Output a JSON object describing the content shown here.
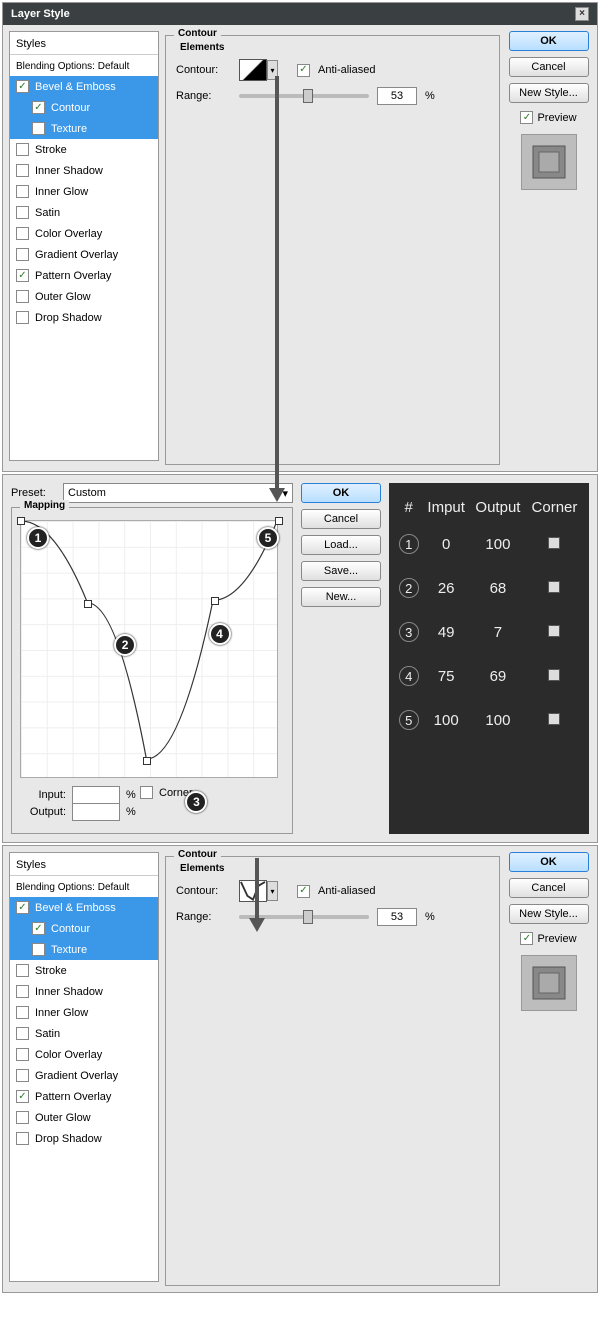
{
  "window": {
    "title": "Layer Style"
  },
  "styles_panel": {
    "header": "Styles",
    "blending": "Blending Options: Default",
    "items": [
      {
        "label": "Bevel & Emboss",
        "checked": true,
        "selected": true,
        "sub": false
      },
      {
        "label": "Contour",
        "checked": true,
        "selected": true,
        "sub": true
      },
      {
        "label": "Texture",
        "checked": false,
        "selected": true,
        "sub": true
      },
      {
        "label": "Stroke",
        "checked": false,
        "selected": false,
        "sub": false
      },
      {
        "label": "Inner Shadow",
        "checked": false,
        "selected": false,
        "sub": false
      },
      {
        "label": "Inner Glow",
        "checked": false,
        "selected": false,
        "sub": false
      },
      {
        "label": "Satin",
        "checked": false,
        "selected": false,
        "sub": false
      },
      {
        "label": "Color Overlay",
        "checked": false,
        "selected": false,
        "sub": false
      },
      {
        "label": "Gradient Overlay",
        "checked": false,
        "selected": false,
        "sub": false
      },
      {
        "label": "Pattern Overlay",
        "checked": true,
        "selected": false,
        "sub": false
      },
      {
        "label": "Outer Glow",
        "checked": false,
        "selected": false,
        "sub": false
      },
      {
        "label": "Drop Shadow",
        "checked": false,
        "selected": false,
        "sub": false
      }
    ]
  },
  "contour_section": {
    "group_title": "Contour",
    "sub_title": "Elements",
    "contour_label": "Contour:",
    "antialias_label": "Anti-aliased",
    "antialias_checked": true,
    "range_label": "Range:",
    "range_value": "53",
    "range_unit": "%"
  },
  "right_buttons": {
    "ok": "OK",
    "cancel": "Cancel",
    "newstyle": "New Style...",
    "preview_label": "Preview",
    "preview_checked": true
  },
  "editor": {
    "preset_label": "Preset:",
    "preset_value": "Custom",
    "mapping_label": "Mapping",
    "input_label": "Input:",
    "output_label": "Output:",
    "percent": "%",
    "corner_label": "Corner",
    "buttons": {
      "ok": "OK",
      "cancel": "Cancel",
      "load": "Load...",
      "save": "Save...",
      "new": "New..."
    }
  },
  "chart_data": {
    "type": "line",
    "title": "Mapping",
    "xlabel": "Input",
    "ylabel": "Output",
    "xlim": [
      0,
      100
    ],
    "ylim": [
      0,
      100
    ],
    "columns": [
      "#",
      "Imput",
      "Output",
      "Corner"
    ],
    "points": [
      {
        "n": 1,
        "input": 0,
        "output": 100,
        "corner": false
      },
      {
        "n": 2,
        "input": 26,
        "output": 68,
        "corner": false
      },
      {
        "n": 3,
        "input": 49,
        "output": 7,
        "corner": false
      },
      {
        "n": 4,
        "input": 75,
        "output": 69,
        "corner": false
      },
      {
        "n": 5,
        "input": 100,
        "output": 100,
        "corner": false
      }
    ]
  }
}
